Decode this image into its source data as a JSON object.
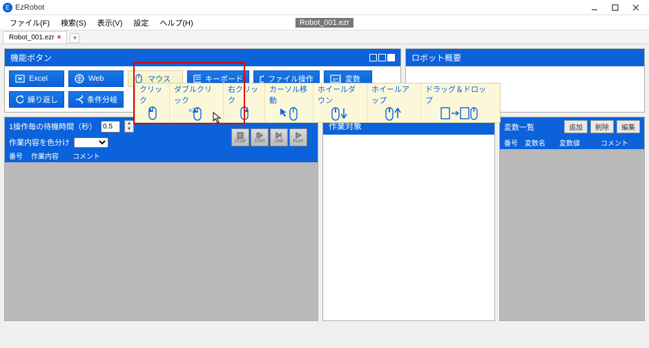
{
  "titlebar": {
    "app_name": "EzRobot"
  },
  "menubar": {
    "items": [
      "ファイル(F)",
      "検索(S)",
      "表示(V)",
      "設定",
      "ヘルプ(H)"
    ],
    "center_badge": "Robot_001.ezr"
  },
  "tabs": {
    "active": "Robot_001.ezr"
  },
  "function_panel": {
    "title": "機能ボタン",
    "buttons_row1": [
      {
        "label": "Excel",
        "icon": "excel-icon"
      },
      {
        "label": "Web",
        "icon": "globe-icon"
      },
      {
        "label": "マウス",
        "icon": "mouse-icon",
        "selected": true
      },
      {
        "label": "キーボード",
        "icon": "keyboard-icon"
      },
      {
        "label": "ファイル操作",
        "icon": "folder-icon"
      },
      {
        "label": "変数",
        "icon": "a1-icon"
      }
    ],
    "buttons_row2": [
      {
        "label": "繰り返し",
        "icon": "refresh-icon"
      },
      {
        "label": "条件分岐",
        "icon": "branch-icon"
      }
    ]
  },
  "mouse_popover": {
    "items": [
      {
        "label": "クリック"
      },
      {
        "label": "ダブルクリック"
      },
      {
        "label": "右クリック"
      },
      {
        "label": "カーソル移動"
      },
      {
        "label": "ホイールダウン"
      },
      {
        "label": "ホイールアップ"
      },
      {
        "label": "ドラッグ＆ドロップ"
      }
    ]
  },
  "overview_panel": {
    "title": "ロボット概要"
  },
  "ops_panel": {
    "wait_label": "1操作毎の待機時間（秒）",
    "wait_value": "0.5",
    "color_label": "作業内容を色分け",
    "cols": {
      "no": "番号",
      "content": "作業内容",
      "comment": "コメント"
    },
    "playctrl": [
      "STOP",
      "STEP",
      "LINE",
      "PLAY"
    ]
  },
  "target_panel": {
    "title": "作業対象"
  },
  "vars_panel": {
    "title": "変数一覧",
    "buttons": {
      "add": "追加",
      "del": "削除",
      "edit": "編集"
    },
    "cols": {
      "no": "番号",
      "name": "変数名",
      "value": "変数値",
      "comment": "コメント"
    }
  }
}
